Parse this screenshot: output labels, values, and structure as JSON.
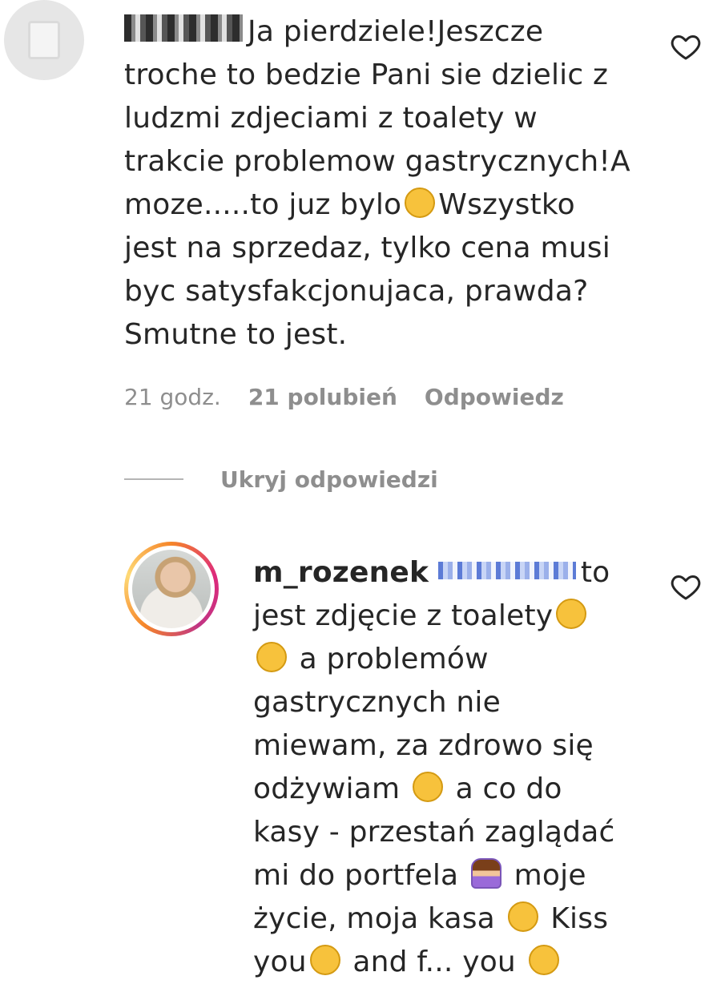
{
  "comment1": {
    "text_lines": [
      "Ja pierdziele!Jeszcze",
      "troche to bedzie Pani sie dzielic z",
      "ludzmi zdjeciami z toalety w",
      "trakcie problemow gastrycznych!A",
      "moze.....to juz bylo",
      "Wszystko",
      "jest na sprzedaz, tylko cena musi",
      "byc satysfakcjonujaca, prawda?",
      "Smutne to jest."
    ],
    "time": "21 godz.",
    "likes": "21 polubień",
    "reply": "Odpowiedz",
    "thinking_emoji": "thinking-face-icon"
  },
  "hide_replies": "Ukryj odpowiedzi",
  "comment2": {
    "username": "m_rozenek",
    "p1": "to",
    "p2": "jest zdjęcie z toalety",
    "p3": "a problemów",
    "p4": "gastrycznych nie",
    "p5": "miewam, za zdrowo się",
    "p6": "odżywiam",
    "p7": "a co do",
    "p8": "kasy - przestań zaglądać",
    "p9": "mi do portfela",
    "p10": "moje",
    "p11": "życie, moja kasa",
    "p12": "Kiss",
    "p13": "you",
    "p14": "and f... you"
  },
  "colors": {
    "text": "#262626",
    "muted": "#8e8e8e",
    "ring_orange": "#f58529",
    "ring_pink": "#dd2a7b"
  }
}
